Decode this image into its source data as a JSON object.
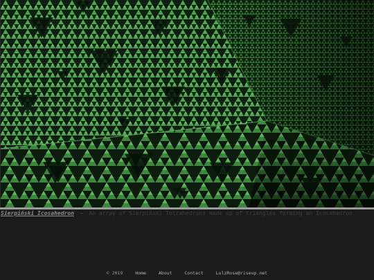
{
  "colors": {
    "background": "#1b1b1b",
    "fractal_dark": "#0c1a0d",
    "fractal_light": "#6dc06b",
    "divider": "#9a9a9a"
  },
  "hero": {
    "image_icon": "sierpinski-icosahedron-fractal"
  },
  "caption": {
    "title": "Sierpiński Icosahedron",
    "separator": "~",
    "description": "An array of Sierpiński Tetrahedrons made up of triangles forming an Icosahedron"
  },
  "footer": {
    "copyright": "© 2019",
    "links": [
      "Home",
      "About",
      "Contact"
    ],
    "email": "LulzRose@riseup.net"
  }
}
